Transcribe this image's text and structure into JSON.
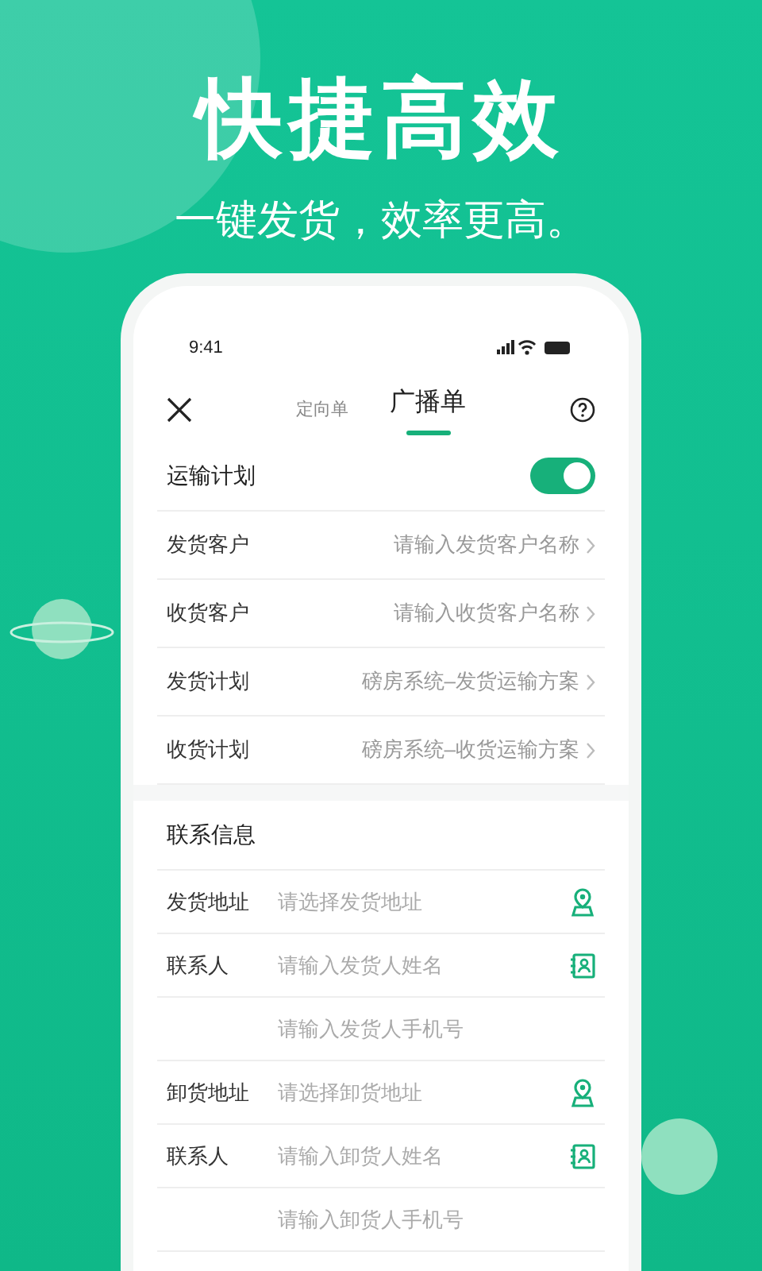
{
  "headline": "快捷高效",
  "subtitle": "一键发货，效率更高。",
  "phone": {
    "status_bar": {
      "time": "9:41"
    },
    "nav": {
      "tabs": [
        {
          "label": "定向单",
          "selected": false
        },
        {
          "label": "广播单",
          "selected": true
        }
      ]
    },
    "transport_plan": {
      "label": "运输计划",
      "on": true
    },
    "rows": [
      {
        "label": "发货客户",
        "placeholder": "请输入发货客户名称"
      },
      {
        "label": "收货客户",
        "placeholder": "请输入收货客户名称"
      },
      {
        "label": "发货计划",
        "placeholder": "磅房系统–发货运输方案"
      },
      {
        "label": "收货计划",
        "placeholder": "磅房系统–收货运输方案"
      }
    ],
    "contact": {
      "title": "联系信息",
      "rows": [
        {
          "label": "发货地址",
          "placeholder": "请选择发货地址",
          "kind": "location"
        },
        {
          "label": "联系人",
          "placeholder": "请输入发货人姓名",
          "kind": "contact"
        },
        {
          "placeholder": "请输入发货人手机号",
          "kind": "plain"
        },
        {
          "label": "卸货地址",
          "placeholder": "请选择卸货地址",
          "kind": "location"
        },
        {
          "label": "联系人",
          "placeholder": "请输入卸货人姓名",
          "kind": "contact"
        },
        {
          "placeholder": "请输入卸货人手机号",
          "kind": "plain"
        }
      ]
    }
  }
}
